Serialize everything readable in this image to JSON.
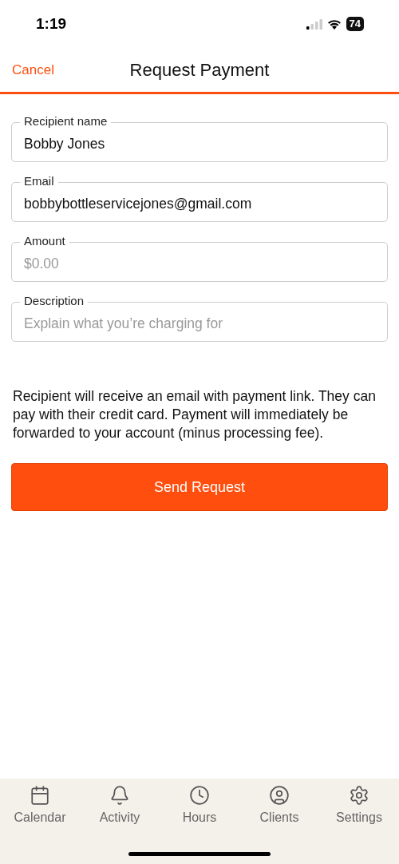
{
  "status_bar": {
    "time": "1:19",
    "battery": "74"
  },
  "nav": {
    "cancel": "Cancel",
    "title": "Request Payment"
  },
  "fields": [
    {
      "label": "Recipient name",
      "value": "Bobby Jones"
    },
    {
      "label": "Email",
      "value": "bobbybottleservicejones@gmail.com"
    },
    {
      "label": "Amount",
      "placeholder": "$0.00"
    },
    {
      "label": "Description",
      "placeholder": "Explain what you’re charging for"
    }
  ],
  "note": "Recipient will receive an email with payment link. They can pay with their credit card. Payment will immediately be forwarded to your account (minus processing fee).",
  "send_button": "Send Request",
  "tab_bar": [
    {
      "label": "Calendar"
    },
    {
      "label": "Activity"
    },
    {
      "label": "Hours"
    },
    {
      "label": "Clients"
    },
    {
      "label": "Settings"
    }
  ]
}
